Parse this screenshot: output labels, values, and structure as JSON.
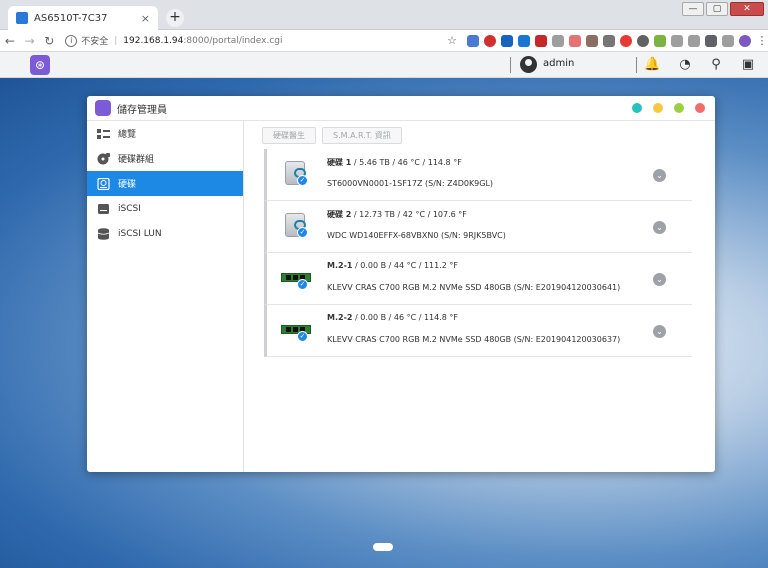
{
  "browser": {
    "tab_title": "AS6510T-7C37",
    "tab_close": "×",
    "new_tab": "+",
    "insecure_label": "不安全",
    "url_host": "192.168.1.94",
    "url_path": ":8000/portal/index.cgi",
    "win_min": "—",
    "win_max": "▢",
    "win_close": "✕"
  },
  "nas": {
    "username": "admin"
  },
  "window": {
    "title": "儲存管理員",
    "dot_colors": [
      "#26c3bb",
      "#f6c944",
      "#9bd046",
      "#f26d6d"
    ]
  },
  "sidebar": {
    "items": [
      {
        "label": "總覽",
        "icon": "overview-icon"
      },
      {
        "label": "硬碟群組",
        "icon": "volume-icon"
      },
      {
        "label": "硬碟",
        "icon": "disk-icon",
        "active": true
      },
      {
        "label": "iSCSI",
        "icon": "iscsi-icon"
      },
      {
        "label": "iSCSI LUN",
        "icon": "iscsi-lun-icon"
      }
    ]
  },
  "toolbar": {
    "health_label": "硬碟醫生",
    "smart_label": "S.M.A.R.T. 資訊"
  },
  "disks": [
    {
      "name": "硬碟 1",
      "info": " / 5.46 TB / 46 °C / 114.8 °F",
      "model": "ST6000VN0001-1SF17Z (S/N: Z4D0K9GL)",
      "type": "hdd"
    },
    {
      "name": "硬碟 2",
      "info": " / 12.73 TB / 42 °C / 107.6 °F",
      "model": "WDC WD140EFFX-68VBXN0 (S/N: 9RJK5BVC)",
      "type": "hdd"
    },
    {
      "name": "M.2-1",
      "info": " / 0.00 B / 44 °C / 111.2 °F",
      "model": "KLEVV CRAS C700 RGB M.2 NVMe SSD 480GB (S/N: E201904120030641)",
      "type": "ssd"
    },
    {
      "name": "M.2-2",
      "info": " / 0.00 B / 46 °C / 114.8 °F",
      "model": "KLEVV CRAS C700 RGB M.2 NVMe SSD 480GB (S/N: E201904120030637)",
      "type": "ssd"
    }
  ]
}
